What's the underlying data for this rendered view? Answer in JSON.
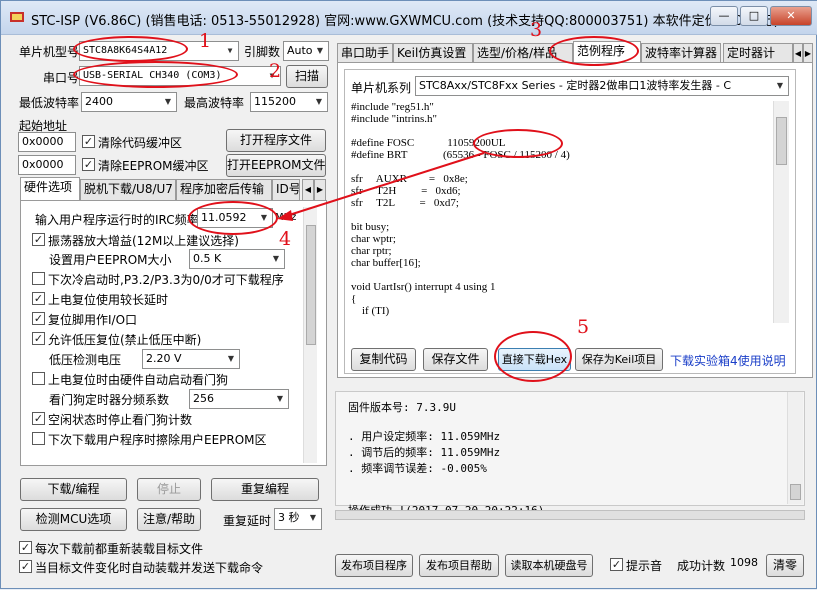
{
  "app": {
    "title": "STC-ISP (V6.86C) (销售电话: 0513-55012928) 官网:www.GXWMCU.com (技术支持QQ:800003751) 本软件定价: 6000元(…",
    "min": "—",
    "max": "□",
    "close": "✕"
  },
  "left": {
    "mcu_label": "单片机型号",
    "mcu_value": "STC8A8K64S4A12",
    "pins_label": "引脚数",
    "pins_value": "Auto",
    "port_label": "串口号",
    "port_value": "USB-SERIAL CH340 (COM3)",
    "scan": "扫描",
    "minbaud_label": "最低波特率",
    "minbaud": "2400",
    "maxbaud_label": "最高波特率",
    "maxbaud": "115200",
    "start_label": "起始地址",
    "addr1": "0x0000",
    "clear_code": "清除代码缓冲区",
    "open_prog": "打开程序文件",
    "addr2": "0x0000",
    "clear_eeprom": "清除EEPROM缓冲区",
    "open_eeprom": "打开EEPROM文件",
    "tabs": [
      "硬件选项",
      "脱机下载/U8/U7",
      "程序加密后传输",
      "ID号"
    ],
    "irc_label": "输入用户程序运行时的IRC频率",
    "irc_value": "11.0592",
    "irc_unit": "MHz",
    "opt_osc": "振荡器放大增益(12M以上建议选择)",
    "eeprom_size_label": "设置用户EEPROM大小",
    "eeprom_size": "0.5 K",
    "opt_cold": "下次冷启动时,P3.2/P3.3为0/0才可下载程序",
    "opt_reset_delay": "上电复位使用较长延时",
    "opt_reset_pin": "复位脚用作I/O口",
    "opt_lowvolt": "允许低压复位(禁止低压中断)",
    "lowvolt_label": "低压检测电压",
    "lowvolt": "2.20 V",
    "opt_wdt": "上电复位时由硬件自动启动看门狗",
    "wdt_div_label": "看门狗定时器分频系数",
    "wdt_div": "256",
    "opt_idle": "空闲状态时停止看门狗计数",
    "opt_erase": "下次下载用户程序时擦除用户EEPROM区",
    "download": "下载/编程",
    "stop": "停止",
    "reprogram": "重复编程",
    "check_mcu": "检测MCU选项",
    "help": "注意/帮助",
    "delay_label": "重复延时",
    "delay": "3 秒",
    "reload": "每次下载前都重新装载目标文件",
    "autoload": "当目标文件变化时自动装载并发送下载命令"
  },
  "right": {
    "tabs": [
      "串口助手",
      "Keil仿真设置",
      "选型/价格/样品",
      "范例程序",
      "波特率计算器",
      "定时器计"
    ],
    "series_label": "单片机系列",
    "series_value": "STC8Axx/STC8Fxx Series - 定时器2做串口1波特率发生器 - C",
    "code": "#include \"reg51.h\"\n#include \"intrins.h\"\n\n#define FOSC            11059200UL\n#define BRT             (65536 - FOSC / 115200 / 4)\n\nsfr     AUXR        =   0x8e;\nsfr     T2H         =   0xd6;\nsfr     T2L         =   0xd7;\n\nbit busy;\nchar wptr;\nchar rptr;\nchar buffer[16];\n\nvoid UartIsr() interrupt 4 using 1\n{\n    if (TI)",
    "copy": "复制代码",
    "save": "保存文件",
    "direct": "直接下载Hex",
    "save_keil": "保存为Keil项目",
    "help_link": "下载实验箱4使用说明",
    "log": "固件版本号: 7.3.9U\n\n. 用户设定频率: 11.059MHz\n. 调节后的频率: 11.059MHz\n. 频率调节误差: -0.005%\n\n\n操作成功 !(2017-07-20 20:22:16)",
    "publish": "发布项目程序",
    "publish_help": "发布项目帮助",
    "read_disk": "读取本机硬盘号",
    "sound": "提示音",
    "count_label": "成功计数",
    "count": "1098",
    "clear": "清零"
  },
  "annotations": {
    "n1": "1",
    "n2": "2",
    "n3": "3",
    "n4": "4",
    "n5": "5"
  },
  "colors": {
    "annotation": "#e0101a",
    "link": "#1a3ec8"
  }
}
